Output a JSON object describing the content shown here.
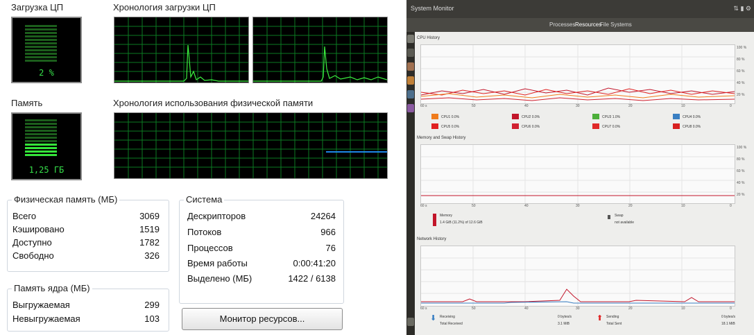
{
  "cpu": {
    "usage_title": "Загрузка ЦП",
    "usage_value": "2 %",
    "history_title": "Хронология загрузки ЦП"
  },
  "memory": {
    "usage_title": "Память",
    "usage_value": "1,25 ГБ",
    "history_title": "Хронология использования физической памяти"
  },
  "physical_memory": {
    "title": "Физическая память (МБ)",
    "rows": [
      {
        "label": "Всего",
        "value": "3069"
      },
      {
        "label": "Кэшировано",
        "value": "1519"
      },
      {
        "label": "Доступно",
        "value": "1782"
      },
      {
        "label": "Свободно",
        "value": "326"
      }
    ]
  },
  "kernel_memory": {
    "title": "Память ядра (МБ)",
    "rows": [
      {
        "label": "Выгружаемая",
        "value": "299"
      },
      {
        "label": "Невыгружаемая",
        "value": "103"
      }
    ]
  },
  "system": {
    "title": "Система",
    "rows": [
      {
        "label": "Дескрипторов",
        "value": "24264"
      },
      {
        "label": "Потоков",
        "value": "966"
      },
      {
        "label": "Процессов",
        "value": "76"
      },
      {
        "label": "Время работы",
        "value": "0:00:41:20"
      },
      {
        "label": "Выделено (МБ)",
        "value": "1422 / 6138"
      }
    ]
  },
  "resource_monitor_button": "Монитор ресурсов...",
  "sysmon": {
    "window_title": "System Monitor",
    "tabs": [
      "Processes",
      "Resources",
      "File Systems"
    ],
    "cpu_section": "CPU History",
    "mem_section": "Memory and Swap History",
    "net_section": "Network History",
    "cpu_legend": [
      {
        "label": "CPU1 0.0%",
        "color": "#f07c1c"
      },
      {
        "label": "CPU2 0.0%",
        "color": "#c2152a"
      },
      {
        "label": "CPU3 1.0%",
        "color": "#4caf3a"
      },
      {
        "label": "CPU4 0.0%",
        "color": "#3a7fc2"
      },
      {
        "label": "CPU5 0.0%",
        "color": "#e02020"
      },
      {
        "label": "CPU6 0.0%",
        "color": "#d02030"
      },
      {
        "label": "CPU7 0.0%",
        "color": "#e02828"
      },
      {
        "label": "CPU8 0.0%",
        "color": "#d82020"
      }
    ],
    "mem_legend": {
      "memory": "Memory",
      "memory_value": "1.4 GiB (11.2%) of 12.6 GiB",
      "swap": "Swap",
      "swap_value": "not available"
    },
    "net_legend": {
      "receiving": "Receiving",
      "total_received": "Total Received",
      "sending": "Sending",
      "total_sent": "Total Sent",
      "recv_rate": "0 bytes/s",
      "recv_total": "3.1 MiB",
      "send_rate": "0 bytes/s",
      "send_total": "18.1 MiB"
    }
  }
}
